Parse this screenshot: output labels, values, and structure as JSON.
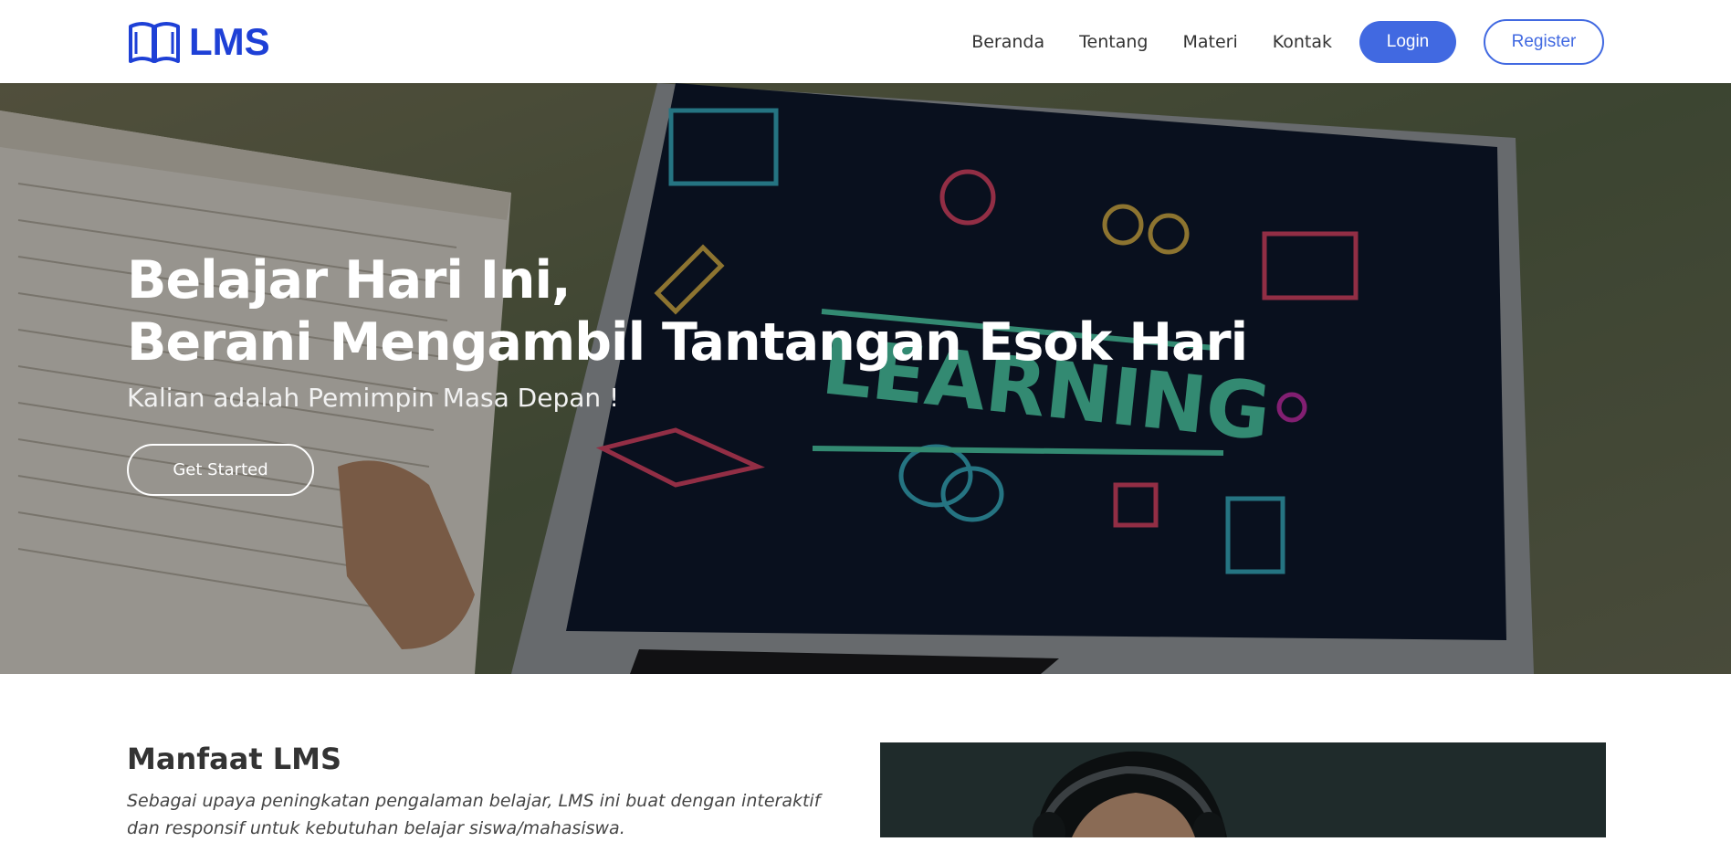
{
  "brand": {
    "name": "LMS",
    "icon": "book-icon",
    "color": "#1e40d6"
  },
  "nav": {
    "links": [
      "Beranda",
      "Tentang",
      "Materi",
      "Kontak"
    ],
    "login_label": "Login",
    "register_label": "Register",
    "accent": "#4169e1"
  },
  "hero": {
    "title_line1": "Belajar Hari Ini,",
    "title_line2": "Berani Mengambil Tantangan Esok Hari",
    "subtitle": "Kalian adalah Pemimpin Masa Depan !",
    "cta_label": "Get Started",
    "screen_word": "LEARNING"
  },
  "about": {
    "title": "Manfaat LMS",
    "text": "Sebagai upaya peningkatan pengalaman belajar, LMS ini buat dengan interaktif dan responsif untuk kebutuhan belajar siswa/mahasiswa."
  }
}
